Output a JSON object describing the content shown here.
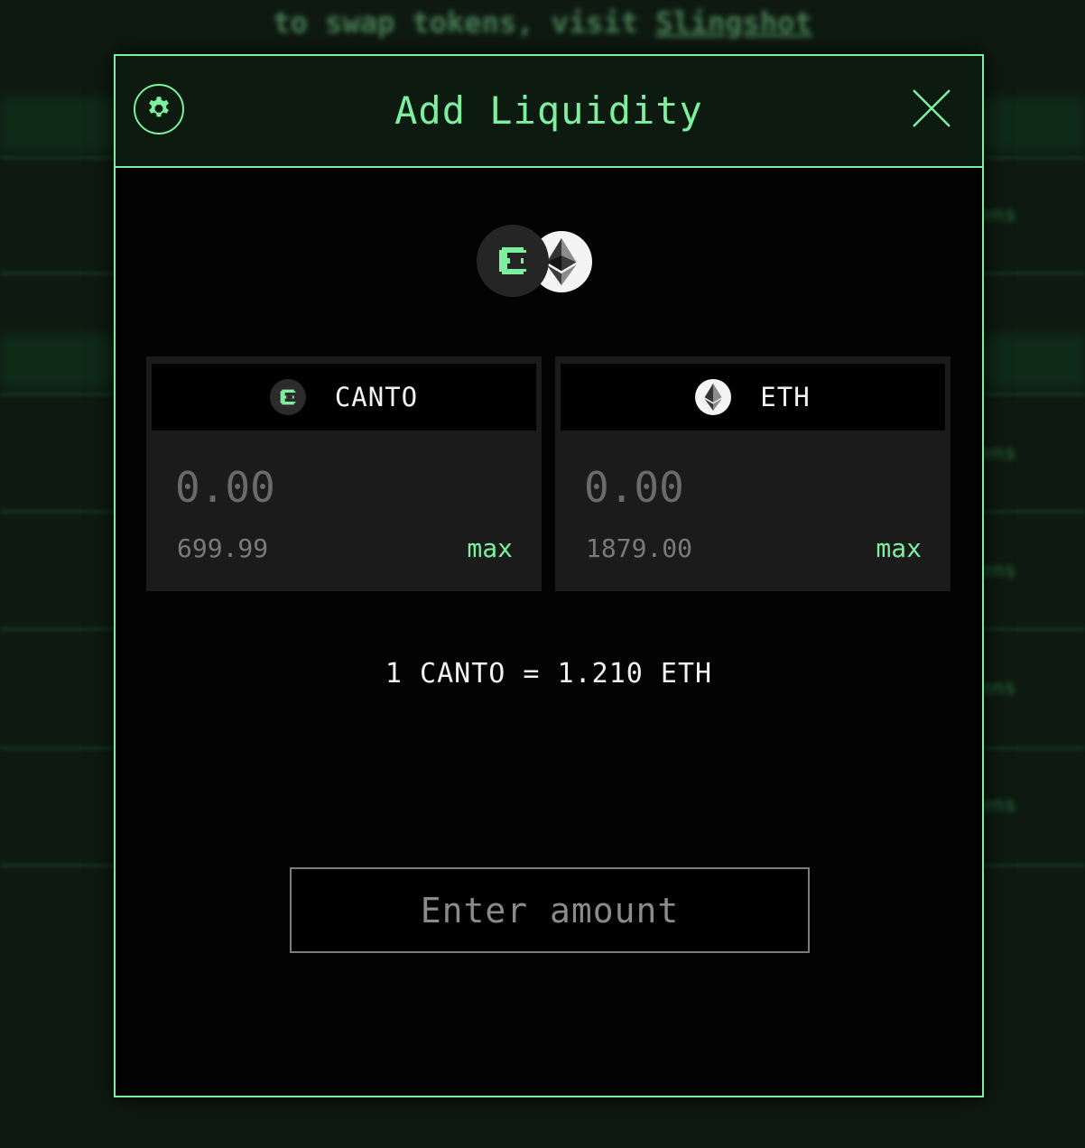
{
  "background": {
    "notice_text": "to swap tokens, visit",
    "notice_link": "Slingshot",
    "side_texts": [
      "ens",
      "ens",
      "ens",
      "ens",
      "ens"
    ]
  },
  "modal": {
    "title": "Add Liquidity",
    "settings_icon": "gear-icon",
    "close_icon": "close-icon"
  },
  "pair": {
    "token_a_icon": "canto-logo-icon",
    "token_b_icon": "eth-logo-icon"
  },
  "tokens": [
    {
      "symbol": "CANTO",
      "icon": "canto-logo-icon",
      "placeholder": "0.00",
      "balance": "699.99",
      "max_label": "max"
    },
    {
      "symbol": "ETH",
      "icon": "eth-logo-icon",
      "placeholder": "0.00",
      "balance": "1879.00",
      "max_label": "max"
    }
  ],
  "rate_text": "1 CANTO = 1.210 ETH",
  "submit_label": "Enter amount",
  "colors": {
    "accent": "#7df0a0",
    "modal_bg": "#030303",
    "header_bg": "#0c1a0f",
    "card_bg": "#1b1b1b",
    "muted_text": "#7a7a7a"
  }
}
